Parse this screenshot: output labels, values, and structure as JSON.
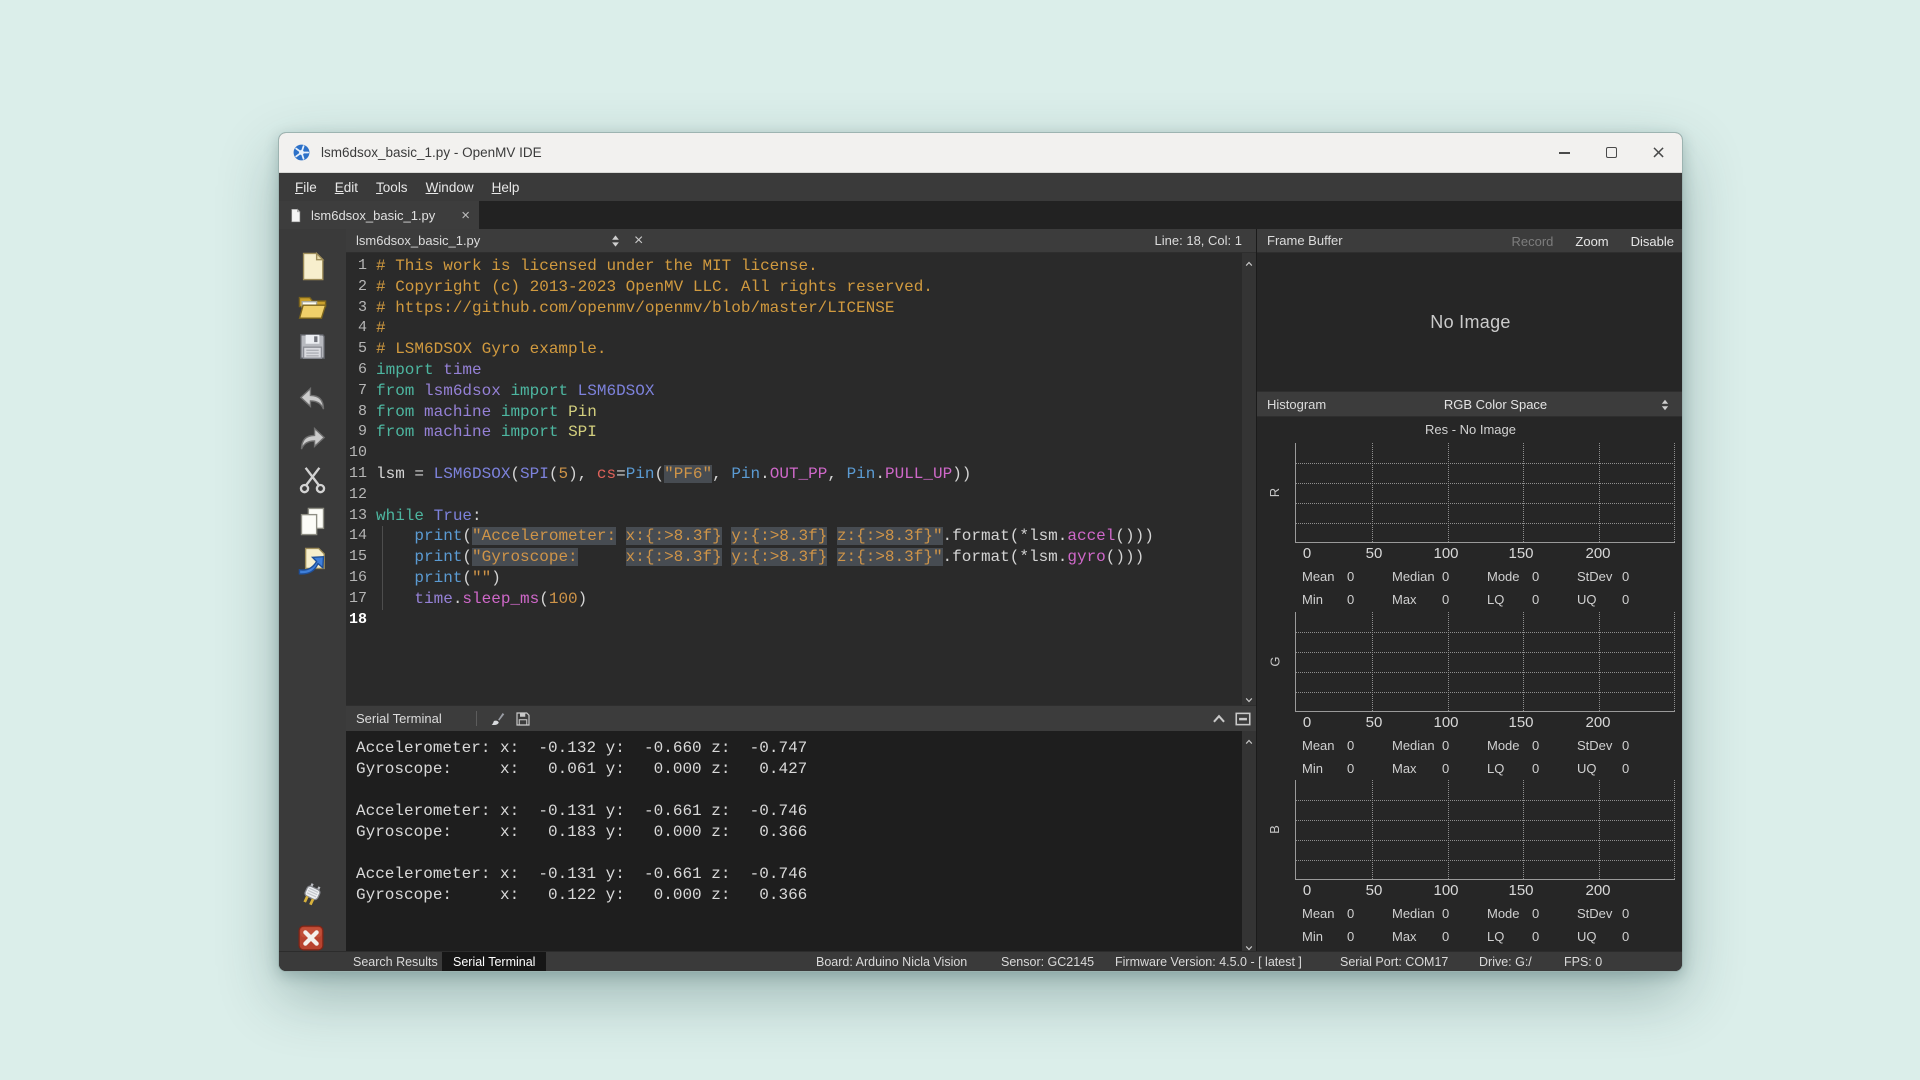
{
  "window": {
    "title": "lsm6dsox_basic_1.py - OpenMV IDE",
    "controls": [
      "minimize",
      "maximize",
      "close"
    ]
  },
  "menu": [
    "File",
    "Edit",
    "Tools",
    "Window",
    "Help"
  ],
  "tab": {
    "label": "lsm6dsox_basic_1.py"
  },
  "editor": {
    "filename": "lsm6dsox_basic_1.py",
    "cursor_position": "Line: 18, Col: 1",
    "code": [
      {
        "n": "1",
        "tokens": [
          [
            "cm",
            "# This work is licensed under the MIT license."
          ]
        ]
      },
      {
        "n": "2",
        "tokens": [
          [
            "cm",
            "# Copyright (c) 2013-2023 OpenMV LLC. All rights reserved."
          ]
        ]
      },
      {
        "n": "3",
        "tokens": [
          [
            "cm",
            "# https://github.com/openmv/openmv/blob/master/LICENSE"
          ]
        ]
      },
      {
        "n": "4",
        "tokens": [
          [
            "cm",
            "#"
          ]
        ]
      },
      {
        "n": "5",
        "tokens": [
          [
            "cm",
            "# LSM6DSOX Gyro example."
          ]
        ]
      },
      {
        "n": "6",
        "tokens": [
          [
            "kw",
            "import"
          ],
          [
            "pl",
            " "
          ],
          [
            "mod",
            "time"
          ]
        ]
      },
      {
        "n": "7",
        "tokens": [
          [
            "kw",
            "from"
          ],
          [
            "pl",
            " "
          ],
          [
            "mod",
            "lsm6dsox"
          ],
          [
            "pl",
            " "
          ],
          [
            "kw",
            "import"
          ],
          [
            "pl",
            " "
          ],
          [
            "cls",
            "LSM6DSOX"
          ]
        ]
      },
      {
        "n": "8",
        "tokens": [
          [
            "kw",
            "from"
          ],
          [
            "pl",
            " "
          ],
          [
            "mod",
            "machine"
          ],
          [
            "pl",
            " "
          ],
          [
            "kw",
            "import"
          ],
          [
            "pl",
            " "
          ],
          [
            "yel",
            "Pin"
          ]
        ]
      },
      {
        "n": "9",
        "tokens": [
          [
            "kw",
            "from"
          ],
          [
            "pl",
            " "
          ],
          [
            "mod",
            "machine"
          ],
          [
            "pl",
            " "
          ],
          [
            "kw",
            "import"
          ],
          [
            "pl",
            " "
          ],
          [
            "yel",
            "SPI"
          ]
        ]
      },
      {
        "n": "10",
        "tokens": []
      },
      {
        "n": "11",
        "tokens": [
          [
            "pl",
            "lsm = "
          ],
          [
            "cls",
            "LSM6DSOX"
          ],
          [
            "pl",
            "("
          ],
          [
            "cls",
            "SPI"
          ],
          [
            "pl",
            "("
          ],
          [
            "num",
            "5"
          ],
          [
            "pl",
            "), "
          ],
          [
            "red",
            "cs"
          ],
          [
            "pl",
            "="
          ],
          [
            "fn",
            "Pin"
          ],
          [
            "pl",
            "("
          ],
          [
            "strh",
            "\"PF6\""
          ],
          [
            "pl",
            ", "
          ],
          [
            "fn",
            "Pin"
          ],
          [
            "pl",
            "."
          ],
          [
            "attr",
            "OUT_PP"
          ],
          [
            "pl",
            ", "
          ],
          [
            "fn",
            "Pin"
          ],
          [
            "pl",
            "."
          ],
          [
            "attr",
            "PULL_UP"
          ],
          [
            "pl",
            "))"
          ]
        ]
      },
      {
        "n": "12",
        "tokens": []
      },
      {
        "n": "13",
        "tokens": [
          [
            "kw",
            "while"
          ],
          [
            "pl",
            " "
          ],
          [
            "cls",
            "True"
          ],
          [
            "pl",
            ":"
          ]
        ]
      },
      {
        "n": "14",
        "guide": true,
        "tokens": [
          [
            "pl",
            "    "
          ],
          [
            "fn",
            "print"
          ],
          [
            "pl",
            "("
          ],
          [
            "strh",
            "\"Accelerometer:"
          ],
          [
            "pl",
            " "
          ],
          [
            "strh",
            "x:{:>8.3f}"
          ],
          [
            "pl",
            " "
          ],
          [
            "strh",
            "y:{:>8.3f}"
          ],
          [
            "pl",
            " "
          ],
          [
            "strh",
            "z:{:>8.3f}\""
          ],
          [
            "pl",
            ".format(*lsm."
          ],
          [
            "attr",
            "accel"
          ],
          [
            "pl",
            "()))"
          ]
        ]
      },
      {
        "n": "15",
        "guide": true,
        "tokens": [
          [
            "pl",
            "    "
          ],
          [
            "fn",
            "print"
          ],
          [
            "pl",
            "("
          ],
          [
            "strh",
            "\"Gyroscope:"
          ],
          [
            "pl",
            "     "
          ],
          [
            "strh",
            "x:{:>8.3f}"
          ],
          [
            "pl",
            " "
          ],
          [
            "strh",
            "y:{:>8.3f}"
          ],
          [
            "pl",
            " "
          ],
          [
            "strh",
            "z:{:>8.3f}\""
          ],
          [
            "pl",
            ".format(*lsm."
          ],
          [
            "attr",
            "gyro"
          ],
          [
            "pl",
            "()))"
          ]
        ]
      },
      {
        "n": "16",
        "guide": true,
        "tokens": [
          [
            "pl",
            "    "
          ],
          [
            "fn",
            "print"
          ],
          [
            "pl",
            "("
          ],
          [
            "str",
            "\"\""
          ],
          [
            "pl",
            ")"
          ]
        ]
      },
      {
        "n": "17",
        "guide": true,
        "tokens": [
          [
            "pl",
            "    "
          ],
          [
            "mod",
            "time"
          ],
          [
            "pl",
            "."
          ],
          [
            "attr",
            "sleep_ms"
          ],
          [
            "pl",
            "("
          ],
          [
            "num",
            "100"
          ],
          [
            "pl",
            ")"
          ]
        ]
      },
      {
        "n": "18",
        "current": true,
        "tokens": []
      }
    ]
  },
  "terminal": {
    "title": "Serial Terminal",
    "lines": [
      "Accelerometer: x:  -0.132 y:  -0.660 z:  -0.747",
      "Gyroscope:     x:   0.061 y:   0.000 z:   0.427",
      "",
      "Accelerometer: x:  -0.131 y:  -0.661 z:  -0.746",
      "Gyroscope:     x:   0.183 y:   0.000 z:   0.366",
      "",
      "Accelerometer: x:  -0.131 y:  -0.661 z:  -0.746",
      "Gyroscope:     x:   0.122 y:   0.000 z:   0.366"
    ]
  },
  "frame_buffer": {
    "title": "Frame Buffer",
    "actions": [
      {
        "label": "Record",
        "disabled": true
      },
      {
        "label": "Zoom",
        "disabled": false
      },
      {
        "label": "Disable",
        "disabled": false
      }
    ],
    "placeholder": "No Image"
  },
  "histogram": {
    "title": "Histogram",
    "color_space": "RGB Color Space",
    "resolution": "Res - No Image",
    "channels": [
      {
        "name": "R",
        "ticks": [
          "0",
          "50",
          "100",
          "150",
          "200"
        ],
        "stats": {
          "row1": [
            [
              "Mean",
              "0"
            ],
            [
              "Median",
              "0"
            ],
            [
              "Mode",
              "0"
            ],
            [
              "StDev",
              "0"
            ]
          ],
          "row2": [
            [
              "Min",
              "0"
            ],
            [
              "Max",
              "0"
            ],
            [
              "LQ",
              "0"
            ],
            [
              "UQ",
              "0"
            ]
          ]
        }
      },
      {
        "name": "G",
        "ticks": [
          "0",
          "50",
          "100",
          "150",
          "200"
        ],
        "stats": {
          "row1": [
            [
              "Mean",
              "0"
            ],
            [
              "Median",
              "0"
            ],
            [
              "Mode",
              "0"
            ],
            [
              "StDev",
              "0"
            ]
          ],
          "row2": [
            [
              "Min",
              "0"
            ],
            [
              "Max",
              "0"
            ],
            [
              "LQ",
              "0"
            ],
            [
              "UQ",
              "0"
            ]
          ]
        }
      },
      {
        "name": "B",
        "ticks": [
          "0",
          "50",
          "100",
          "150",
          "200"
        ],
        "stats": {
          "row1": [
            [
              "Mean",
              "0"
            ],
            [
              "Median",
              "0"
            ],
            [
              "Mode",
              "0"
            ],
            [
              "StDev",
              "0"
            ]
          ],
          "row2": [
            [
              "Min",
              "0"
            ],
            [
              "Max",
              "0"
            ],
            [
              "LQ",
              "0"
            ],
            [
              "UQ",
              "0"
            ]
          ]
        }
      }
    ]
  },
  "status_bar": {
    "tabs": [
      {
        "label": "Search Results",
        "active": false
      },
      {
        "label": "Serial Terminal",
        "active": true
      }
    ],
    "fields": [
      {
        "label": "Board:",
        "value": "Arduino Nicla Vision"
      },
      {
        "label": "Sensor:",
        "value": "GC2145"
      },
      {
        "label": "Firmware Version:",
        "value": "4.5.0 - [ latest ]"
      },
      {
        "label": "Serial Port:",
        "value": "COM17"
      },
      {
        "label": "Drive:",
        "value": "G:/"
      },
      {
        "label": "FPS:",
        "value": "0"
      }
    ]
  },
  "toolbar": {
    "top": [
      "new-file",
      "open-file",
      "save-file",
      "undo",
      "redo",
      "cut",
      "copy",
      "paste"
    ],
    "bottom": [
      "connect",
      "stop"
    ]
  },
  "colors": {
    "desktop_bg": "#dbeeea",
    "chrome": "#3c3c3c",
    "editor_bg": "#2a2a2a",
    "terminal_bg": "#1e1e1e",
    "panel_bg": "#262626",
    "titlebar_bg": "#f2f1ef",
    "comment": "#d19a3f",
    "keyword": "#4db6a0",
    "module": "#9581d6",
    "class": "#7d82dc",
    "function": "#5b9bd3",
    "string": "#cf9448",
    "attribute": "#cf68c9",
    "parameter": "#e0625a",
    "stop_red": "#b8432f",
    "logo_blue": "#2d71c8"
  }
}
